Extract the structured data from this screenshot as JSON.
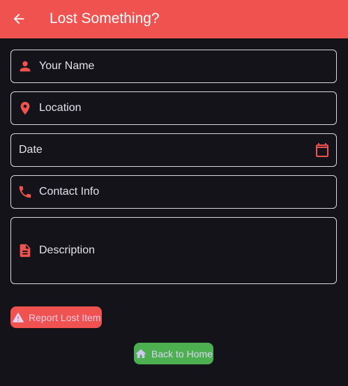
{
  "appbar": {
    "title": "Lost Something?",
    "back_icon": "arrow-back-icon",
    "background": "#f0524f"
  },
  "form": {
    "fields": [
      {
        "label": "Your Name",
        "icon": "person-icon"
      },
      {
        "label": "Location",
        "icon": "location-pin-icon"
      },
      {
        "label": "Date",
        "trailing_icon": "calendar-icon"
      },
      {
        "label": "Contact Info",
        "icon": "phone-icon"
      },
      {
        "label": "Description",
        "icon": "document-icon"
      }
    ]
  },
  "actions": {
    "report_label": "Report Lost Item",
    "report_icon": "warning-icon",
    "home_label": "Back to Home",
    "home_icon": "home-icon"
  },
  "colors": {
    "accent": "#f0524f",
    "background": "#15131a",
    "home_button": "#4caf50"
  }
}
